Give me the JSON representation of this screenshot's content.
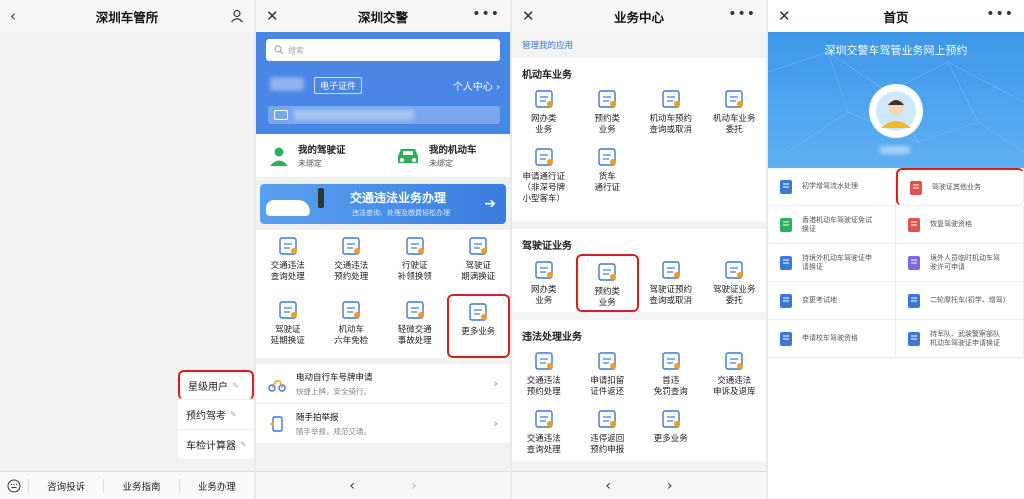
{
  "panel1": {
    "title": "深圳车管所",
    "menu": [
      "星级用户",
      "预约驾考",
      "车检计算器"
    ],
    "bottom": [
      "咨询投诉",
      "业务指南",
      "业务办理"
    ]
  },
  "panel2": {
    "title": "深圳交警",
    "search_placeholder": "搜索",
    "ecert": "电子证件",
    "personal_center": "个人中心",
    "license": {
      "title": "我的驾驶证",
      "status": "未绑定"
    },
    "vehicle": {
      "title": "我的机动车",
      "status": "未绑定"
    },
    "banner": {
      "title": "交通违法业务办理",
      "subtitle": "违法查询、处理及缴费轻松办理"
    },
    "grid": [
      "交通违法\n查询处理",
      "交通违法\n预约处理",
      "行驶证\n补领换领",
      "驾驶证\n期满换证",
      "驾驶证\n延期换证",
      "机动车\n六年免检",
      "轻微交通\n事故处理",
      "更多业务"
    ],
    "list": [
      {
        "title": "电动自行车号牌申请",
        "sub": "快捷上牌，安全骑行。"
      },
      {
        "title": "随手拍举报",
        "sub": "随手举报，规范交通。"
      }
    ]
  },
  "panel3": {
    "title": "业务中心",
    "manage": "管理我的应用",
    "sections": [
      {
        "header": "机动车业务",
        "items": [
          "网办类\n业务",
          "预约类\n业务",
          "机动车预约\n查询或取消",
          "机动车业务\n委托",
          "申请通行证\n（非深号牌\n小型客车）",
          "货车\n通行证"
        ]
      },
      {
        "header": "驾驶证业务",
        "items": [
          "网办类\n业务",
          "预约类\n业务",
          "驾驶证预约\n查询或取消",
          "驾驶证业务\n委托"
        ]
      },
      {
        "header": "违法处理业务",
        "items": [
          "交通违法\n预约处理",
          "申请扣留\n证件返还",
          "首违\n免罚查询",
          "交通违法\n申诉及退库",
          "交通违法\n查询处理",
          "违停返回\n预约申报",
          "更多业务"
        ]
      }
    ]
  },
  "panel4": {
    "title": "首页",
    "hero": "深圳交警车驾管业务网上预约",
    "items": [
      "初学增驾流水处理",
      "驾驶证其他业务",
      "香港机动车驾驶证免试\n换证",
      "恢复驾驶资格",
      "持境外机动车驾驶证申\n请换证",
      "境外人员临时机动车驾\n驶许可申请",
      "变更考试地",
      "二轮摩托车(初学、增驾)",
      "申请校车驾驶资格",
      "持军队、武装警察部队\n机动车驾驶证申请换证"
    ]
  },
  "colors": {
    "accent": "#3b78d8",
    "highlight": "#d42020",
    "hero_blue": "#3d97e8",
    "header_blue": "#4a86e6"
  }
}
